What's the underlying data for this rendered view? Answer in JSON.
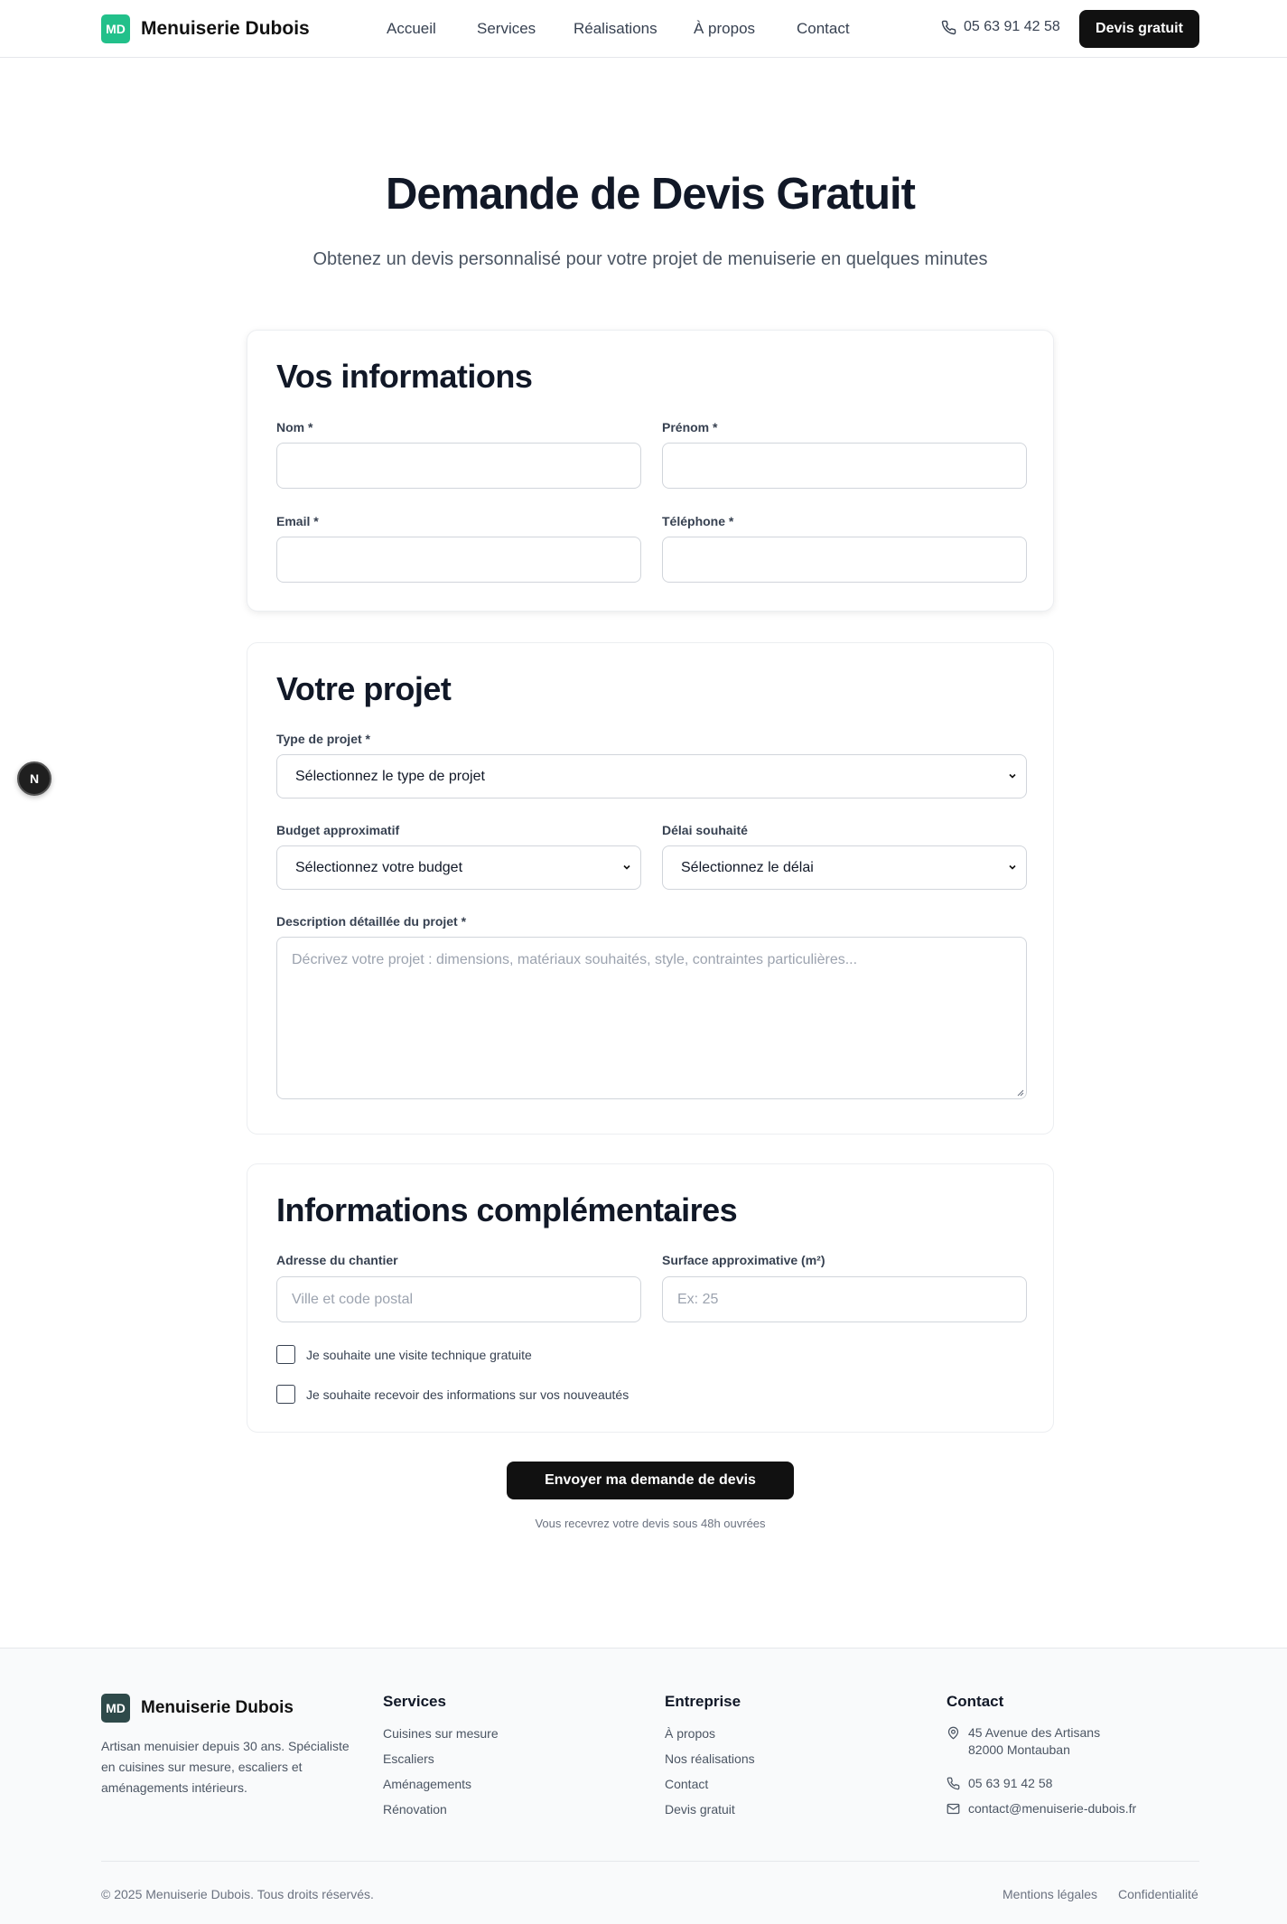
{
  "header": {
    "logo_initials": "MD",
    "brand": "Menuiserie Dubois",
    "nav": [
      "Accueil",
      "Services",
      "Réalisations",
      "À propos",
      "Contact"
    ],
    "phone": "05 63 91 42 58",
    "cta": "Devis gratuit"
  },
  "hero": {
    "title": "Demande de Devis Gratuit",
    "subtitle": "Obtenez un devis personnalisé pour votre projet de menuiserie en quelques minutes"
  },
  "info_card": {
    "title": "Vos informations",
    "nom_label": "Nom *",
    "prenom_label": "Prénom *",
    "email_label": "Email *",
    "telephone_label": "Téléphone *"
  },
  "project_card": {
    "title": "Votre projet",
    "type_label": "Type de projet *",
    "type_value": "Sélectionnez le type de projet",
    "budget_label": "Budget approximatif",
    "budget_value": "Sélectionnez votre budget",
    "delai_label": "Délai souhaité",
    "delai_value": "Sélectionnez le délai",
    "description_label": "Description détaillée du projet *",
    "description_placeholder": "Décrivez votre projet : dimensions, matériaux souhaités, style, contraintes particulières..."
  },
  "extra_card": {
    "title": "Informations complémentaires",
    "adresse_label": "Adresse du chantier",
    "adresse_placeholder": "Ville et code postal",
    "surface_label": "Surface approximative (m²)",
    "surface_placeholder": "Ex: 25",
    "check_visite": "Je souhaite une visite technique gratuite",
    "check_news": "Je souhaite recevoir des informations sur vos nouveautés"
  },
  "submit": {
    "label": "Envoyer ma demande de devis",
    "note": "Vous recevrez votre devis sous 48h ouvrées"
  },
  "dev_badge": "N",
  "footer": {
    "logo_initials": "MD",
    "brand": "Menuiserie Dubois",
    "description": "Artisan menuisier depuis 30 ans. Spécialiste en cuisines sur mesure, escaliers et aménagements intérieurs.",
    "services_title": "Services",
    "services": [
      "Cuisines sur mesure",
      "Escaliers",
      "Aménagements",
      "Rénovation"
    ],
    "company_title": "Entreprise",
    "company": [
      "À propos",
      "Nos réalisations",
      "Contact",
      "Devis gratuit"
    ],
    "contact_title": "Contact",
    "address_line1": "45 Avenue des Artisans",
    "address_line2": "82000 Montauban",
    "phone": "05 63 91 42 58",
    "email": "contact@menuiserie-dubois.fr",
    "copyright": "© 2025 Menuiserie Dubois. Tous droits réservés.",
    "legal": "Mentions légales",
    "privacy": "Confidentialité"
  },
  "icons": {
    "phone": "phone-icon",
    "pin": "map-pin-icon",
    "mail": "mail-icon",
    "chevron": "chevron-down-icon"
  },
  "colors": {
    "logo_green": "#22c08a",
    "footer_logo": "#2f4a4a",
    "primary_dark": "#111111"
  }
}
